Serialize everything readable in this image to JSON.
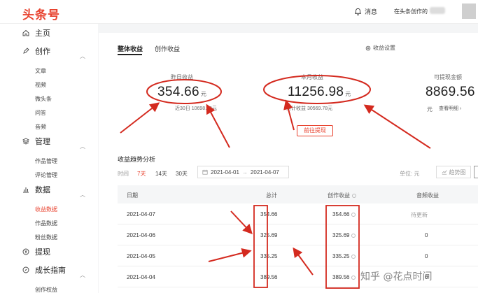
{
  "header": {
    "logo": "头条号",
    "messages_label": "消息",
    "creator_label": "在头条创作的"
  },
  "sidebar": {
    "home": "主页",
    "create": "创作",
    "create_items": [
      "文章",
      "视频",
      "微头条",
      "问答",
      "音频"
    ],
    "manage": "管理",
    "manage_items": [
      "作品管理",
      "评论管理"
    ],
    "data": "数据",
    "data_items": [
      "收益数据",
      "作品数据",
      "粉丝数据"
    ],
    "withdraw": "提现",
    "growth": "成长指南",
    "growth_items": [
      "创作权益"
    ]
  },
  "tabs": [
    "整体收益",
    "创作收益"
  ],
  "settings_label": "收益设置",
  "stats": {
    "yesterday": {
      "label": "昨日收益",
      "value": "354.66",
      "unit": "元",
      "sub": "近30日 10698.59元"
    },
    "month": {
      "label": "本月收益",
      "value": "11256.98",
      "unit": "元",
      "sub": "累计收益 30569.78元"
    },
    "withdrawable": {
      "label": "可提现金额",
      "value": "8869.56",
      "unit": "元",
      "sub": "查看明细 ›"
    }
  },
  "withdraw_button": "前往提现",
  "trend": {
    "title": "收益趋势分析",
    "time_label": "时间",
    "ranges": [
      "7天",
      "14天",
      "30天"
    ],
    "date_from": "2021-04-01",
    "date_sep": "→",
    "date_to": "2021-04-07",
    "unit_label": "单位: 元",
    "chart_button": "趋势图"
  },
  "table": {
    "headers": [
      "日期",
      "总计",
      "创作收益",
      "音频收益"
    ],
    "rows": [
      {
        "date": "2021-04-07",
        "total": "354.66",
        "creation": "354.66",
        "audio": "待更新"
      },
      {
        "date": "2021-04-06",
        "total": "325.69",
        "creation": "325.69",
        "audio": "0"
      },
      {
        "date": "2021-04-05",
        "total": "335.25",
        "creation": "335.25",
        "audio": "0"
      },
      {
        "date": "2021-04-04",
        "total": "389.56",
        "creation": "389.56",
        "audio": "0"
      }
    ]
  },
  "watermark": "知乎 @花点时间",
  "colors": {
    "brand": "#e8412d",
    "annotation": "#d42a1f"
  }
}
